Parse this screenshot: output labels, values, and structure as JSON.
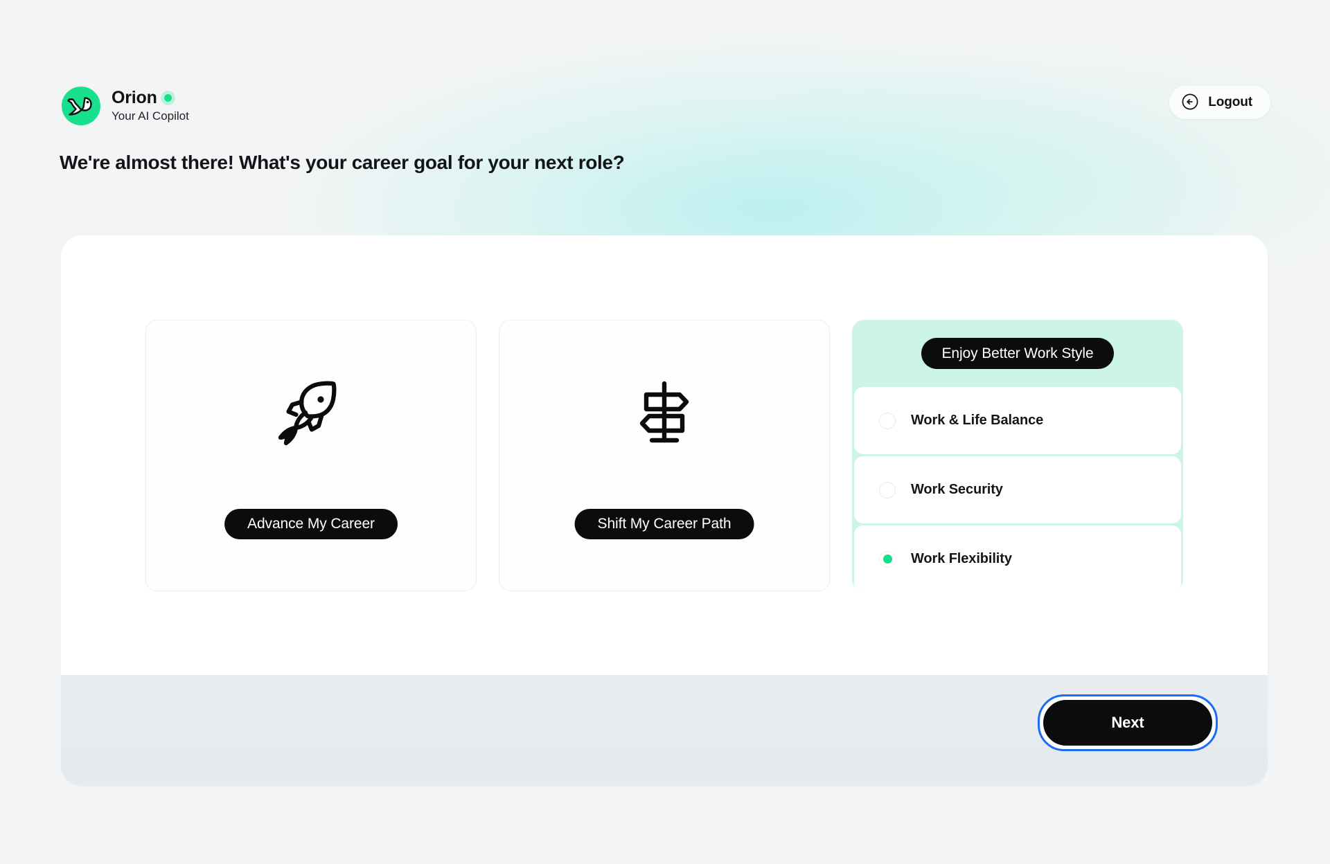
{
  "brand": {
    "name": "Orion",
    "tagline": "Your AI Copilot",
    "logo_icon": "bird-logo-icon",
    "status_dot_color": "#17e08a",
    "logo_bg_color": "#19e08c"
  },
  "header": {
    "logout_label": "Logout",
    "logout_icon": "arrow-left-circle-icon"
  },
  "headline": "We're almost there! What's your career goal for your next role?",
  "choices": [
    {
      "id": "advance-my-career",
      "label": "Advance My Career",
      "icon": "rocket-icon"
    },
    {
      "id": "shift-my-career-path",
      "label": "Shift My Career Path",
      "icon": "signpost-icon"
    }
  ],
  "work_style": {
    "title": "Enjoy Better Work Style",
    "background_color": "#ccf5e5",
    "selected": "Work Flexibility",
    "options": [
      {
        "label": "Work & Life Balance",
        "selected": false
      },
      {
        "label": "Work Security",
        "selected": false
      },
      {
        "label": "Work Flexibility",
        "selected": true
      }
    ]
  },
  "footer": {
    "next_label": "Next",
    "focus_ring_color": "#1a6cf5"
  }
}
